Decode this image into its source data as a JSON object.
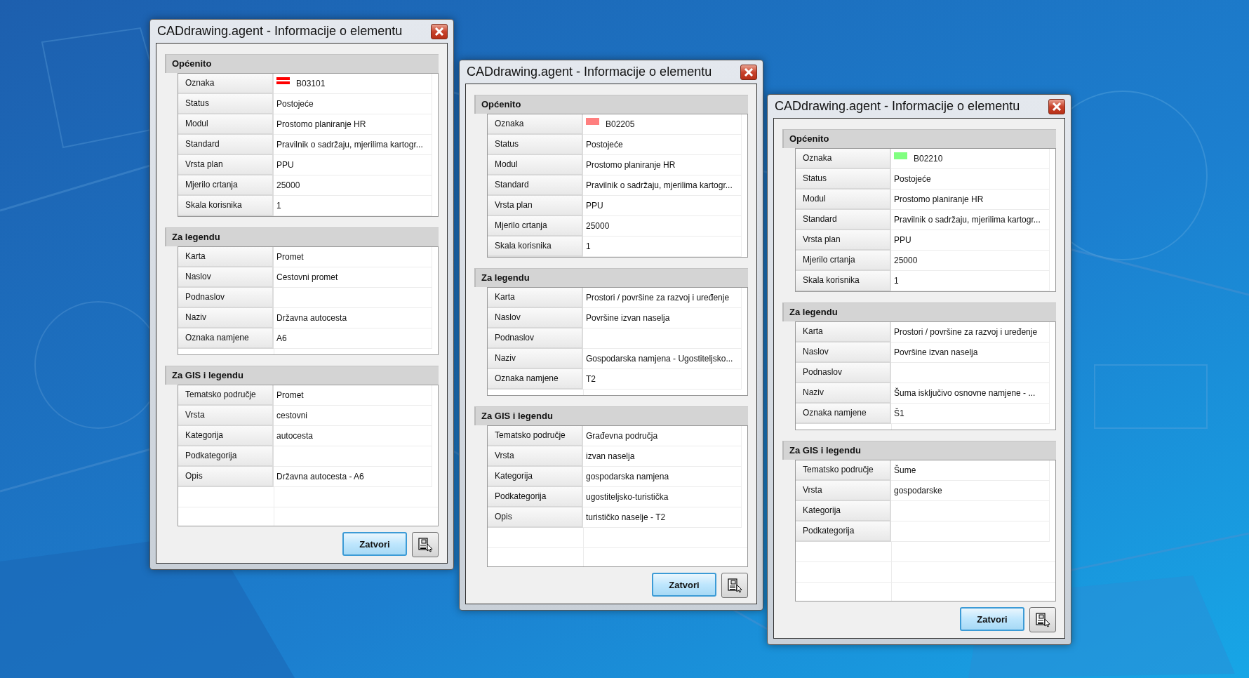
{
  "windows": [
    {
      "title": "CADdrawing.agent - Informacije o elementu",
      "sections": [
        {
          "title": "Općenito",
          "rows": [
            {
              "label": "Oznaka",
              "value": "B03101",
              "swatch": {
                "color": "#ff0000",
                "kind": "stripes"
              }
            },
            {
              "label": "Status",
              "value": "Postojeće"
            },
            {
              "label": "Modul",
              "value": "Prostomo planiranje HR"
            },
            {
              "label": "Standard",
              "value": "Pravilnik o sadržaju, mjerilima kartogr..."
            },
            {
              "label": "Vrsta plan",
              "value": "PPU"
            },
            {
              "label": "Mjerilo crtanja",
              "value": "25000"
            },
            {
              "label": "Skala korisnika",
              "value": "1"
            }
          ]
        },
        {
          "title": "Za legendu",
          "rows": [
            {
              "label": "Karta",
              "value": "Promet"
            },
            {
              "label": "Naslov",
              "value": "Cestovni promet"
            },
            {
              "label": "Podnaslov"
            },
            {
              "label": "Naziv",
              "value": "Državna autocesta"
            },
            {
              "label": "Oznaka namjene",
              "value": "A6"
            }
          ]
        },
        {
          "title": "Za GIS i legendu",
          "rows": [
            {
              "label": "Tematsko područje",
              "value": "Promet"
            },
            {
              "label": "Vrsta",
              "value": "cestovni"
            },
            {
              "label": "Kategorija",
              "value": "autocesta"
            },
            {
              "label": "Podkategorija"
            },
            {
              "label": "Opis",
              "value": "Državna autocesta - A6"
            }
          ]
        }
      ],
      "button": "Zatvori"
    },
    {
      "title": "CADdrawing.agent - Informacije o elementu",
      "sections": [
        {
          "title": "Općenito",
          "rows": [
            {
              "label": "Oznaka",
              "value": "B02205",
              "swatch": {
                "color": "#ff7f7f",
                "kind": "solid"
              }
            },
            {
              "label": "Status",
              "value": "Postojeće"
            },
            {
              "label": "Modul",
              "value": "Prostomo planiranje HR"
            },
            {
              "label": "Standard",
              "value": "Pravilnik o sadržaju, mjerilima kartogr..."
            },
            {
              "label": "Vrsta plan",
              "value": "PPU"
            },
            {
              "label": "Mjerilo crtanja",
              "value": "25000"
            },
            {
              "label": "Skala korisnika",
              "value": "1"
            }
          ]
        },
        {
          "title": "Za legendu",
          "rows": [
            {
              "label": "Karta",
              "value": "Prostori / površine za razvoj i uređenje"
            },
            {
              "label": "Naslov",
              "value": "Površine izvan naselja"
            },
            {
              "label": "Podnaslov"
            },
            {
              "label": "Naziv",
              "value": "Gospodarska namjena - Ugostiteljsko..."
            },
            {
              "label": "Oznaka namjene",
              "value": "T2"
            }
          ]
        },
        {
          "title": "Za GIS i legendu",
          "rows": [
            {
              "label": "Tematsko područje",
              "value": "Građevna područja"
            },
            {
              "label": "Vrsta",
              "value": "izvan naselja"
            },
            {
              "label": "Kategorija",
              "value": "gospodarska namjena"
            },
            {
              "label": "Podkategorija",
              "value": "ugostiteljsko-turistička"
            },
            {
              "label": "Opis",
              "value": "turističko naselje - T2"
            }
          ]
        }
      ],
      "button": "Zatvori"
    },
    {
      "title": "CADdrawing.agent - Informacije o elementu",
      "sections": [
        {
          "title": "Općenito",
          "rows": [
            {
              "label": "Oznaka",
              "value": "B02210",
              "swatch": {
                "color": "#80ff80",
                "kind": "solid"
              }
            },
            {
              "label": "Status",
              "value": "Postojeće"
            },
            {
              "label": "Modul",
              "value": "Prostomo planiranje HR"
            },
            {
              "label": "Standard",
              "value": "Pravilnik o sadržaju, mjerilima kartogr..."
            },
            {
              "label": "Vrsta plan",
              "value": "PPU"
            },
            {
              "label": "Mjerilo crtanja",
              "value": "25000"
            },
            {
              "label": "Skala korisnika",
              "value": "1"
            }
          ]
        },
        {
          "title": "Za legendu",
          "rows": [
            {
              "label": "Karta",
              "value": "Prostori / površine za razvoj i uređenje"
            },
            {
              "label": "Naslov",
              "value": "Površine izvan naselja"
            },
            {
              "label": "Podnaslov"
            },
            {
              "label": "Naziv",
              "value": "Šuma isključivo osnovne namjene - ..."
            },
            {
              "label": "Oznaka namjene",
              "value": "Š1"
            }
          ]
        },
        {
          "title": "Za GIS i legendu",
          "rows": [
            {
              "label": "Tematsko područje",
              "value": "Šume"
            },
            {
              "label": "Vrsta",
              "value": "gospodarske"
            },
            {
              "label": "Kategorija"
            },
            {
              "label": "Podkategorija"
            }
          ]
        }
      ],
      "button": "Zatvori"
    }
  ]
}
